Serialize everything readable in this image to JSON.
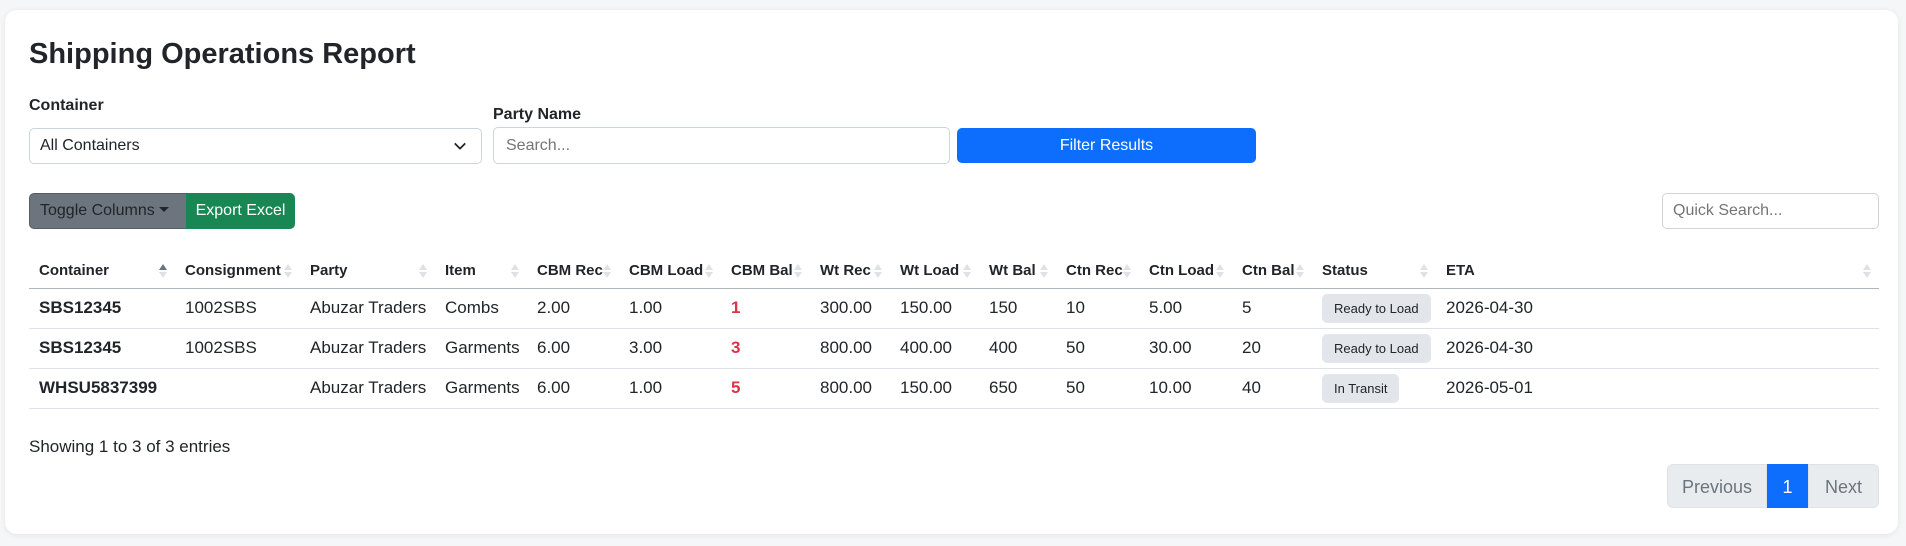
{
  "page_title": "Shipping Operations Report",
  "filters": {
    "container_label": "Container",
    "container_value": "All Containers",
    "party_label": "Party Name",
    "party_placeholder": "Search...",
    "filter_button": "Filter Results"
  },
  "toolbar": {
    "toggle_columns": "Toggle Columns",
    "export_excel": "Export Excel",
    "quick_search_placeholder": "Quick Search..."
  },
  "table": {
    "headers": [
      "Container",
      "Consignment",
      "Party",
      "Item",
      "CBM Rec",
      "CBM Load",
      "CBM Bal",
      "Wt Rec",
      "Wt Load",
      "Wt Bal",
      "Ctn Rec",
      "Ctn Load",
      "Ctn Bal",
      "Status",
      "ETA"
    ],
    "rows": [
      {
        "container": "SBS12345",
        "consignment": "1002SBS",
        "party": "Abuzar Traders",
        "item": "Combs",
        "cbm_rec": "2.00",
        "cbm_load": "1.00",
        "cbm_bal": "1",
        "wt_rec": "300.00",
        "wt_load": "150.00",
        "wt_bal": "150",
        "ctn_rec": "10",
        "ctn_load": "5.00",
        "ctn_bal": "5",
        "status": "Ready to Load",
        "eta": "2026-04-30"
      },
      {
        "container": "SBS12345",
        "consignment": "1002SBS",
        "party": "Abuzar Traders",
        "item": "Garments",
        "cbm_rec": "6.00",
        "cbm_load": "3.00",
        "cbm_bal": "3",
        "wt_rec": "800.00",
        "wt_load": "400.00",
        "wt_bal": "400",
        "ctn_rec": "50",
        "ctn_load": "30.00",
        "ctn_bal": "20",
        "status": "Ready to Load",
        "eta": "2026-04-30"
      },
      {
        "container": "WHSU5837399",
        "consignment": "",
        "party": "Abuzar Traders",
        "item": "Garments",
        "cbm_rec": "6.00",
        "cbm_load": "1.00",
        "cbm_bal": "5",
        "wt_rec": "800.00",
        "wt_load": "150.00",
        "wt_bal": "650",
        "ctn_rec": "50",
        "ctn_load": "10.00",
        "ctn_bal": "40",
        "status": "In Transit",
        "eta": "2026-05-01"
      }
    ]
  },
  "footer": {
    "info": "Showing 1 to 3 of 3 entries",
    "prev": "Previous",
    "current_page": "1",
    "next": "Next"
  },
  "colors": {
    "primary": "#0d6efd",
    "success": "#198754",
    "secondary": "#6c757d",
    "danger": "#dc3545"
  }
}
